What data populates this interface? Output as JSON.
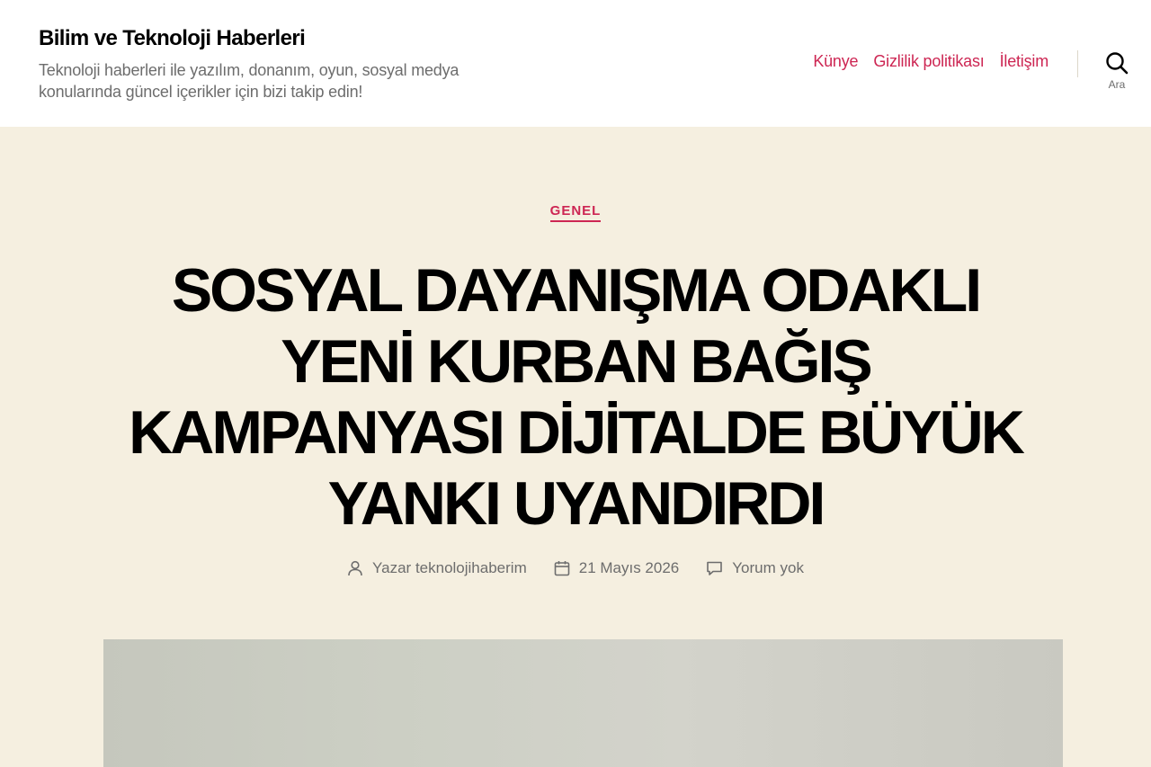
{
  "header": {
    "site_title": "Bilim ve Teknoloji Haberleri",
    "site_description": "Teknoloji haberleri ile yazılım, donanım, oyun, sosyal medya konularında güncel içerikler için bizi takip edin!",
    "menu": [
      {
        "label": "Künye"
      },
      {
        "label": "Gizlilik politikası"
      },
      {
        "label": "İletişim"
      }
    ],
    "search_label": "Ara",
    "accent_color": "#cd2653"
  },
  "entry": {
    "category": "GENEL",
    "title": "SOSYAL DAYANIŞMA ODAKLI YENİ KURBAN BAĞIŞ KAMPANYASI DİJİTALDE BÜYÜK YANKI UYANDIRDI",
    "meta": {
      "author_prefix": "Yazar",
      "author": "teknolojihaberim",
      "date": "21 Mayıs 2026",
      "comments": "Yorum yok"
    }
  },
  "icons": {
    "search": "search-icon",
    "author": "user-icon",
    "date": "calendar-icon",
    "comments": "comment-icon"
  },
  "colors": {
    "background": "#f5efe0",
    "header_background": "#ffffff",
    "meta_text": "#6d6d6d"
  }
}
